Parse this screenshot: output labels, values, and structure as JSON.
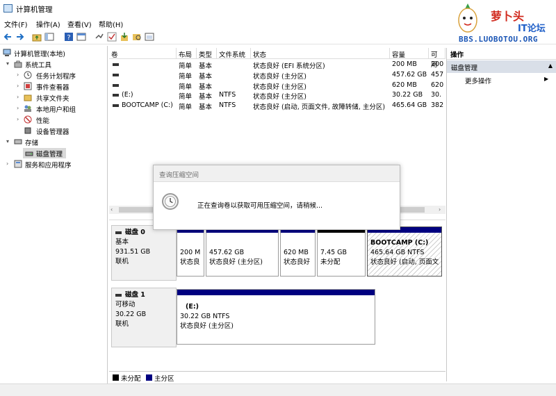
{
  "window": {
    "title": "计算机管理"
  },
  "watermark": {
    "brand": "萝卜头",
    "sub": "IT论坛",
    "url": "BBS.LUOBOTOU.ORG"
  },
  "menu": [
    "文件(F)",
    "操作(A)",
    "查看(V)",
    "帮助(H)"
  ],
  "tree": {
    "root": "计算机管理(本地)",
    "system_tools": "系统工具",
    "task_scheduler": "任务计划程序",
    "event_viewer": "事件查看器",
    "shared_folders": "共享文件夹",
    "local_users": "本地用户和组",
    "performance": "性能",
    "device_manager": "设备管理器",
    "storage": "存储",
    "disk_management": "磁盘管理",
    "services_apps": "服务和应用程序"
  },
  "volume_list": {
    "columns": [
      "卷",
      "布局",
      "类型",
      "文件系统",
      "状态",
      "容量",
      "可用"
    ],
    "rows": [
      {
        "volume": "",
        "layout": "简单",
        "type": "基本",
        "fs": "",
        "status": "状态良好 (EFI 系统分区)",
        "capacity": "200 MB",
        "free": "200"
      },
      {
        "volume": "",
        "layout": "简单",
        "type": "基本",
        "fs": "",
        "status": "状态良好 (主分区)",
        "capacity": "457.62 GB",
        "free": "457"
      },
      {
        "volume": "",
        "layout": "简单",
        "type": "基本",
        "fs": "",
        "status": "状态良好 (主分区)",
        "capacity": "620 MB",
        "free": "620"
      },
      {
        "volume": "(E:)",
        "layout": "简单",
        "type": "基本",
        "fs": "NTFS",
        "status": "状态良好 (主分区)",
        "capacity": "30.22 GB",
        "free": "30."
      },
      {
        "volume": "BOOTCAMP (C:)",
        "layout": "简单",
        "type": "基本",
        "fs": "NTFS",
        "status": "状态良好 (启动, 页面文件, 故障转储, 主分区)",
        "capacity": "465.64 GB",
        "free": "382"
      }
    ]
  },
  "dialog": {
    "title": "查询压缩空间",
    "message": "正在查询卷以获取可用压缩空间，请稍候..."
  },
  "disks": [
    {
      "name": "磁盘 0",
      "type": "基本",
      "size": "931.51 GB",
      "state": "联机",
      "partitions": [
        {
          "label": "",
          "size": "200 M",
          "status": "状态良",
          "color": "#000080"
        },
        {
          "label": "",
          "size": "457.62 GB",
          "status": "状态良好 (主分区)",
          "color": "#000080"
        },
        {
          "label": "",
          "size": "620 MB",
          "status": "状态良好",
          "color": "#000080"
        },
        {
          "label": "",
          "size": "7.45 GB",
          "status": "未分配",
          "color": "#000000"
        },
        {
          "label": "BOOTCAMP  (C:)",
          "size": "465.64 GB NTFS",
          "status": "状态良好 (启动, 页面文",
          "color": "#000080"
        }
      ]
    },
    {
      "name": "磁盘 1",
      "type": "可移动",
      "size": "30.22 GB",
      "state": "联机",
      "partitions": [
        {
          "label": "(E:)",
          "size": "30.22 GB NTFS",
          "status": "状态良好 (主分区)",
          "color": "#000080"
        }
      ]
    }
  ],
  "legend": [
    {
      "label": "未分配",
      "color": "#000000"
    },
    {
      "label": "主分区",
      "color": "#000080"
    }
  ],
  "actions": {
    "header": "操作",
    "section": "磁盘管理",
    "more": "更多操作"
  }
}
